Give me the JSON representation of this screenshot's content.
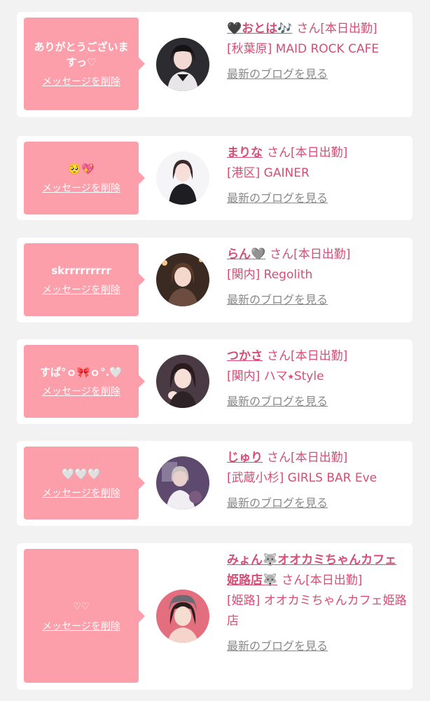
{
  "delete_label": "メッセージを削除",
  "blog_label": "最新のブログを見る",
  "san_label": "さん",
  "shift_label": "[本日出勤]",
  "colors": {
    "accent": "#d64d77",
    "bubble": "#fd9eab",
    "muted": "#888888"
  },
  "cards": [
    {
      "message": "ありがとうございますっ♡",
      "name": "🖤おとは🎶",
      "area": "[秋葉原]",
      "shop": "MAID ROCK CAFE"
    },
    {
      "message": "🥺💖",
      "name": "まりな",
      "area": "[港区]",
      "shop": "GAINER"
    },
    {
      "message": "skrrrrrrrrr",
      "name": "らん🩶",
      "area": "[関内]",
      "shop": "Regolith"
    },
    {
      "message": "すぱ°ｏ🎀ｏ°.🤍",
      "name": "つかさ",
      "area": "[関内]",
      "shop": "ハマ⭑Style"
    },
    {
      "message": "🤍🤍🤍",
      "name": "じゅり",
      "area": "[武蔵小杉]",
      "shop": "GIRLS BAR Eve"
    },
    {
      "message": "♡♡",
      "name": "みょん🐺オオカミちゃんカフェ姫路店🐺",
      "area": "[姫路]",
      "shop": "オオカミちゃんカフェ姫路店"
    }
  ]
}
